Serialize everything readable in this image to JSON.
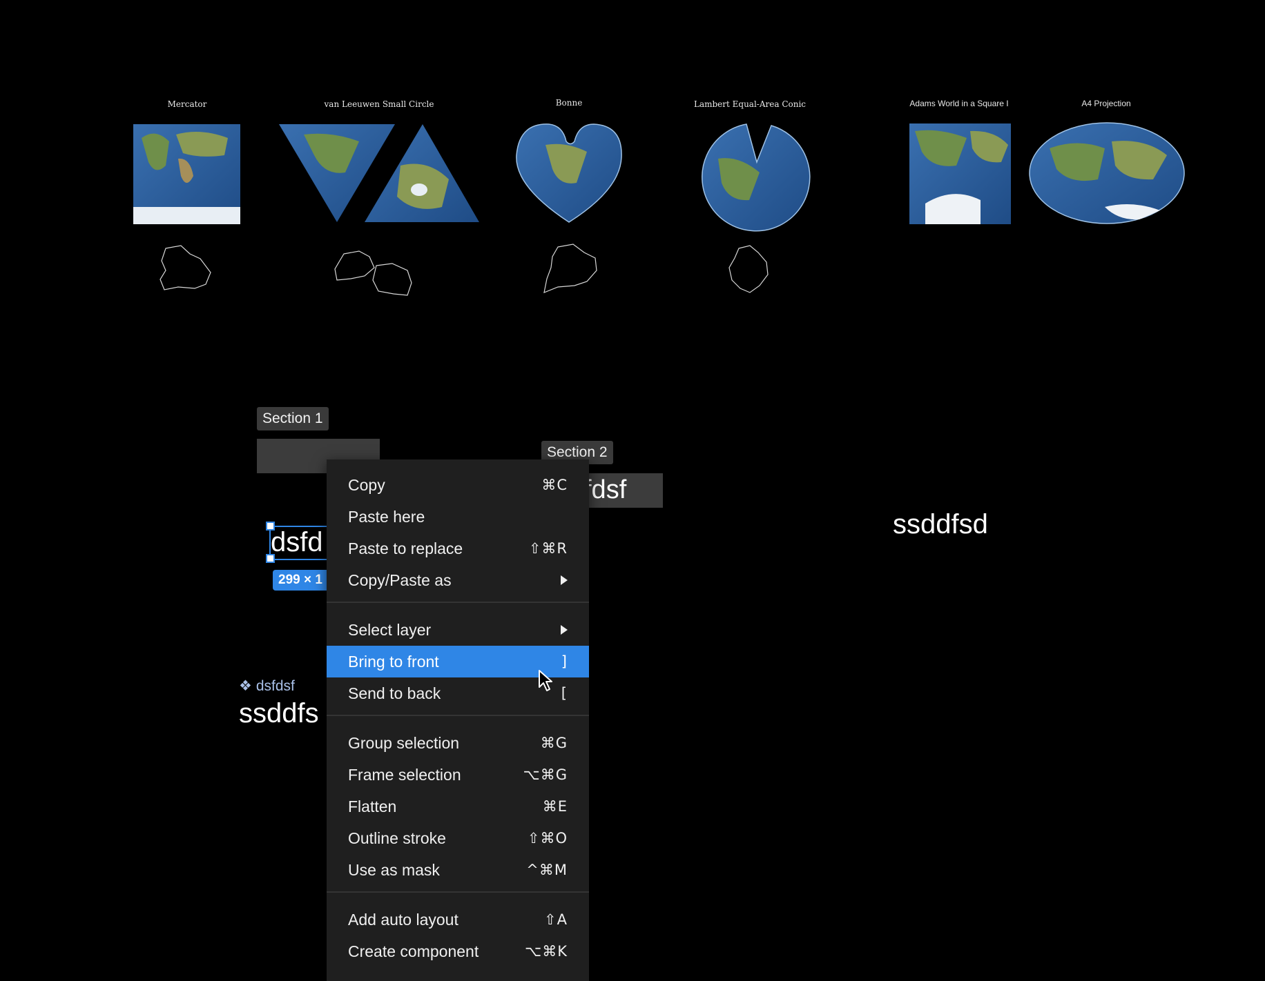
{
  "maps": [
    {
      "label": "Mercator"
    },
    {
      "label": "van Leeuwen Small Circle"
    },
    {
      "label": "Bonne"
    },
    {
      "label": "Lambert Equal-Area Conic"
    },
    {
      "label": "Adams World in a Square I"
    },
    {
      "label": "A4 Projection"
    }
  ],
  "sections": {
    "section1": "Section 1",
    "section2": "Section 2"
  },
  "canvas": {
    "text_partial_right": "fdsf",
    "text_right": "ssddfsd",
    "selected_text": "dsfd",
    "size_badge": "299 × 1",
    "component_label": "dsfdsf",
    "component_text": "ssddfs"
  },
  "context_menu": {
    "groups": [
      [
        {
          "label": "Copy",
          "shortcut": "⌘C"
        },
        {
          "label": "Paste here",
          "shortcut": ""
        },
        {
          "label": "Paste to replace",
          "shortcut": "⇧⌘R"
        },
        {
          "label": "Copy/Paste as",
          "submenu": true
        }
      ],
      [
        {
          "label": "Select layer",
          "submenu": true
        },
        {
          "label": "Bring to front",
          "shortcut": "]",
          "active": true
        },
        {
          "label": "Send to back",
          "shortcut": "["
        }
      ],
      [
        {
          "label": "Group selection",
          "shortcut": "⌘G"
        },
        {
          "label": "Frame selection",
          "shortcut": "⌥⌘G"
        },
        {
          "label": "Flatten",
          "shortcut": "⌘E"
        },
        {
          "label": "Outline stroke",
          "shortcut": "⇧⌘O"
        },
        {
          "label": "Use as mask",
          "shortcut": "^⌘M"
        }
      ],
      [
        {
          "label": "Add auto layout",
          "shortcut": "⇧A"
        },
        {
          "label": "Create component",
          "shortcut": "⌥⌘K"
        }
      ]
    ]
  },
  "colors": {
    "selection": "#2f86e6",
    "menu_bg": "#1f1f1f",
    "ocean": "#2b5f9e",
    "land": "#6f8f4a"
  }
}
